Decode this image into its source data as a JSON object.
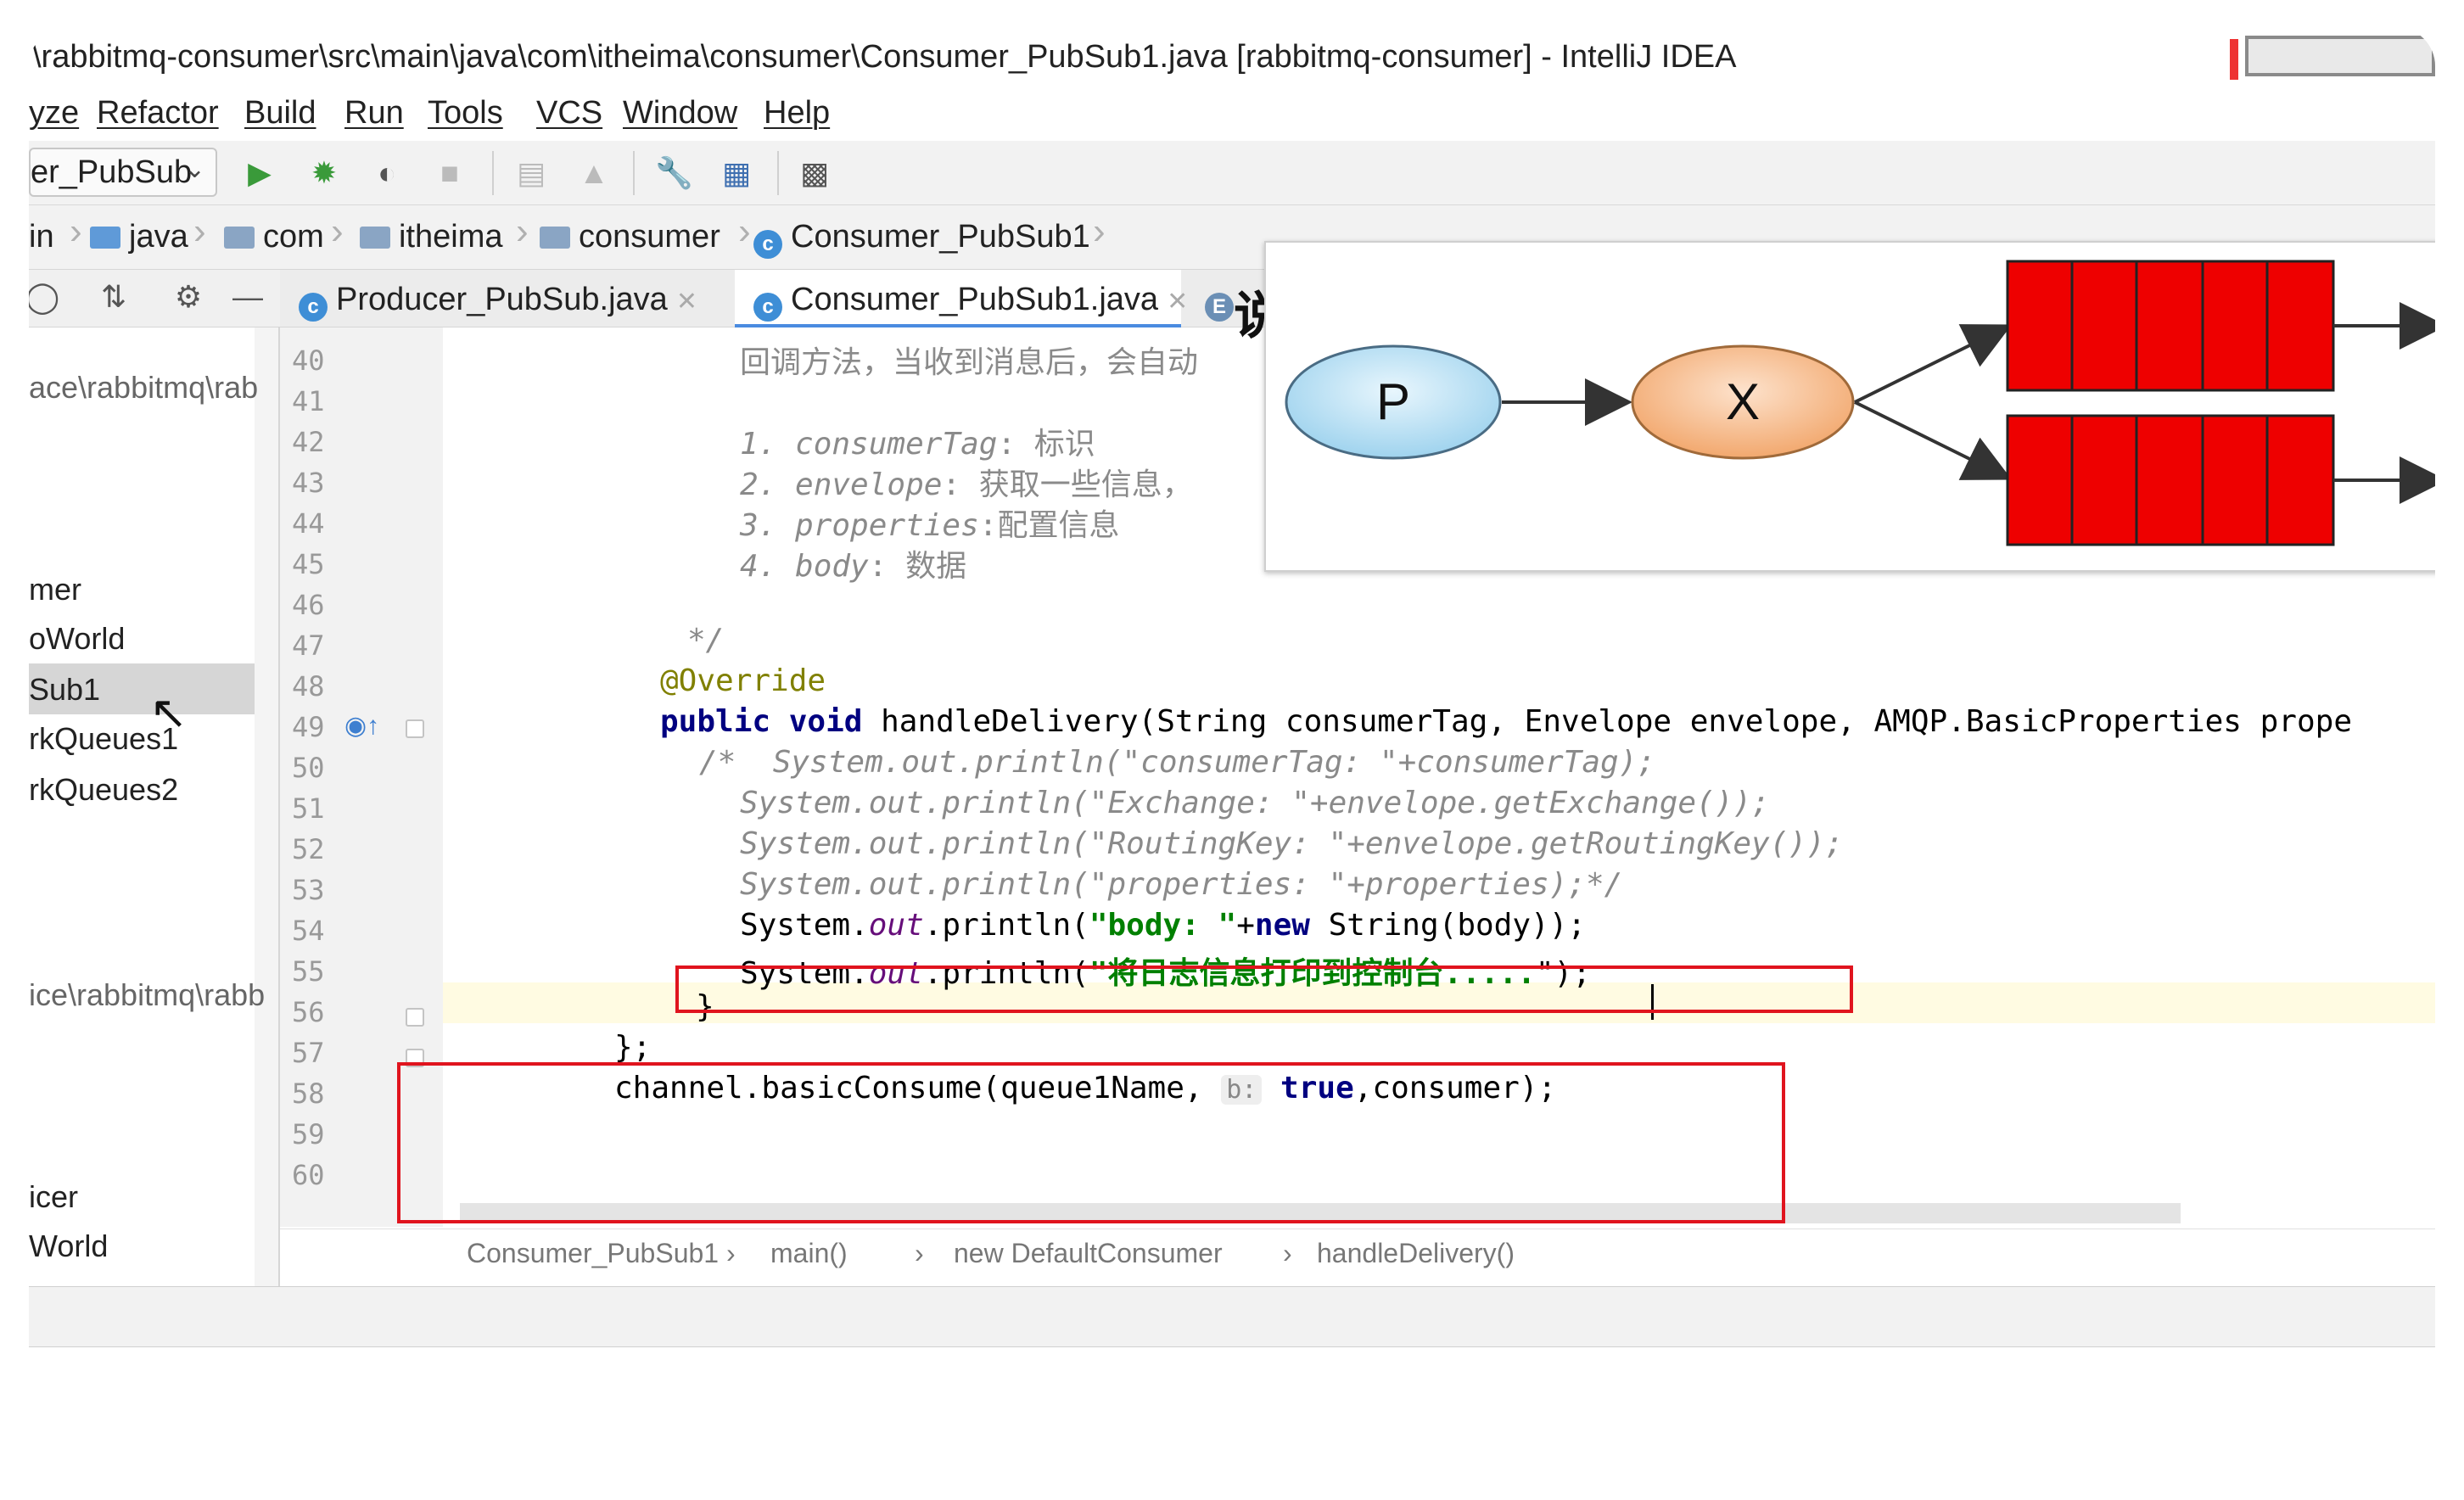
{
  "window": {
    "title": "\\rabbitmq-consumer\\src\\main\\java\\com\\itheima\\consumer\\Consumer_PubSub1.java [rabbitmq-consumer] - IntelliJ IDEA"
  },
  "menu": {
    "items": [
      "yze",
      "Refactor",
      "Build",
      "Run",
      "Tools",
      "VCS",
      "Window",
      "Help"
    ]
  },
  "toolbar": {
    "run_config": "er_PubSub"
  },
  "navbar": {
    "crumbs": [
      "in",
      "java",
      "com",
      "itheima",
      "consumer",
      "Consumer_PubSub1"
    ]
  },
  "tabs": [
    {
      "label": "Producer_PubSub.java"
    },
    {
      "label": "Consumer_PubSub1.java"
    }
  ],
  "sidebar": {
    "items": [
      "ace\\rabbitmq\\rab",
      "mer",
      "oWorld",
      "Sub1",
      "rkQueues1",
      "rkQueues2",
      "ice\\rabbitmq\\rabb",
      "icer",
      "World"
    ]
  },
  "editor": {
    "line_numbers": [
      "40",
      "41",
      "42",
      "43",
      "44",
      "45",
      "46",
      "47",
      "48",
      "49",
      "50",
      "51",
      "52",
      "53",
      "54",
      "55",
      "56",
      "57",
      "58",
      "59",
      "60"
    ],
    "lines": {
      "l40": "回调方法，当收到消息后，会自动",
      "l42a": "1. ",
      "l42b": "consumerTag",
      "l42c": ": 标识",
      "l43a": "2. ",
      "l43b": "envelope",
      "l43c": ": 获取一些信息，",
      "l44a": "3. ",
      "l44b": "properties",
      "l44c": ":配置信息",
      "l45a": "4. ",
      "l45b": "body",
      "l45c": ": 数据",
      "l47": "*/",
      "l48": "@Override",
      "l49_kw": "public void",
      "l49_rest": " handleDelivery(String consumerTag, Envelope envelope, AMQP.BasicProperties prope",
      "l50": "/*  System.out.println(\"consumerTag: \"+consumerTag);",
      "l51": "System.out.println(\"Exchange: \"+envelope.getExchange());",
      "l52": "System.out.println(\"RoutingKey: \"+envelope.getRoutingKey());",
      "l53": "System.out.println(\"properties: \"+properties);*/",
      "l54_a": "System.",
      "l54_b": "out",
      "l54_c": ".println(",
      "l54_str": "\"body: \"",
      "l54_d": "+",
      "l54_kw": "new",
      "l54_e": " String(body));",
      "l55_a": "System.",
      "l55_b": "out",
      "l55_c": ".println(",
      "l55_str": "\"将日志信息打印到控制台.....",
      "l55_end": "\");",
      "l56": "}",
      "l57": "};",
      "l58_a": "channel.basicConsume(queue1Name, ",
      "l58_hint": "b:",
      "l58_kw": " true",
      "l58_b": ",consumer);"
    }
  },
  "bottom_breadcrumbs": [
    "Consumer_PubSub1",
    "main()",
    "new DefaultConsumer",
    "handleDelivery()"
  ],
  "overlay": {
    "heading": "说明",
    "nodes": {
      "producer": "P",
      "exchange": "X"
    },
    "colors": {
      "producer": "#bfe3f5",
      "exchange": "#f9c8a0",
      "queue": "#ee0000"
    }
  },
  "colors": {
    "highlight_box": "#e0141e",
    "keyword": "#000080",
    "string": "#008000",
    "comment": "#8a8a8a"
  }
}
